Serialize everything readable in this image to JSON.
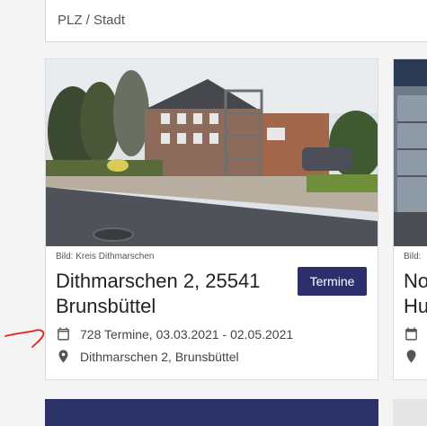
{
  "search": {
    "placeholder": "PLZ / Stadt"
  },
  "cards": [
    {
      "image_caption": "Bild: Kreis Dithmarschen",
      "title_line1": "Dithmarschen 2, 25541",
      "title_line2": "Brunsbüttel",
      "button_label": "Termine",
      "appointments": "728 Termine, 03.03.2021 - 02.05.2021",
      "address": "Dithmarschen 2, Brunsbüttel"
    },
    {
      "image_caption": "Bild:",
      "title_line1": "No",
      "title_line2": "Hu"
    }
  ],
  "colors": {
    "accent": "#2c2f6b",
    "annotation": "#e2231a"
  },
  "icons": [
    "calendar-icon",
    "location-pin-icon"
  ]
}
